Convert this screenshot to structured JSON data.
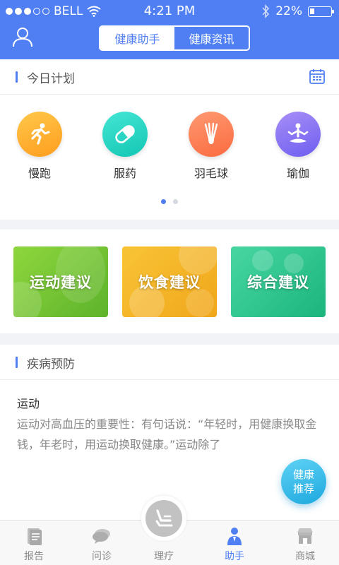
{
  "status_bar": {
    "carrier": "BELL",
    "time": "4:21 PM",
    "battery": "22%"
  },
  "header": {
    "segments": [
      {
        "label": "健康助手",
        "active": true
      },
      {
        "label": "健康资讯",
        "active": false
      }
    ],
    "accent_color": "#4f7ff3"
  },
  "plan": {
    "title": "今日计划",
    "items": [
      {
        "label": "慢跑",
        "icon": "running-icon"
      },
      {
        "label": "服药",
        "icon": "pill-icon"
      },
      {
        "label": "羽毛球",
        "icon": "shuttlecock-icon"
      },
      {
        "label": "瑜伽",
        "icon": "yoga-icon"
      }
    ],
    "page_count": 2,
    "current_page": 1
  },
  "advice": [
    {
      "label": "运动建议"
    },
    {
      "label": "饮食建议"
    },
    {
      "label": "综合建议"
    }
  ],
  "disease": {
    "title": "疾病预防",
    "article_title": "运动",
    "article_body": "运动对高血压的重要性：有句话说：“年轻时，用健康换取金钱，年老时，用运动换取健康。”运动除了"
  },
  "fab": {
    "line1": "健康",
    "line2": "推荐"
  },
  "tabbar": [
    {
      "label": "报告",
      "icon": "report-icon",
      "active": false
    },
    {
      "label": "问诊",
      "icon": "chat-icon",
      "active": false
    },
    {
      "label": "理疗",
      "icon": "massage-chair-icon",
      "active": false
    },
    {
      "label": "助手",
      "icon": "assistant-icon",
      "active": true
    },
    {
      "label": "商城",
      "icon": "shop-icon",
      "active": false
    }
  ]
}
